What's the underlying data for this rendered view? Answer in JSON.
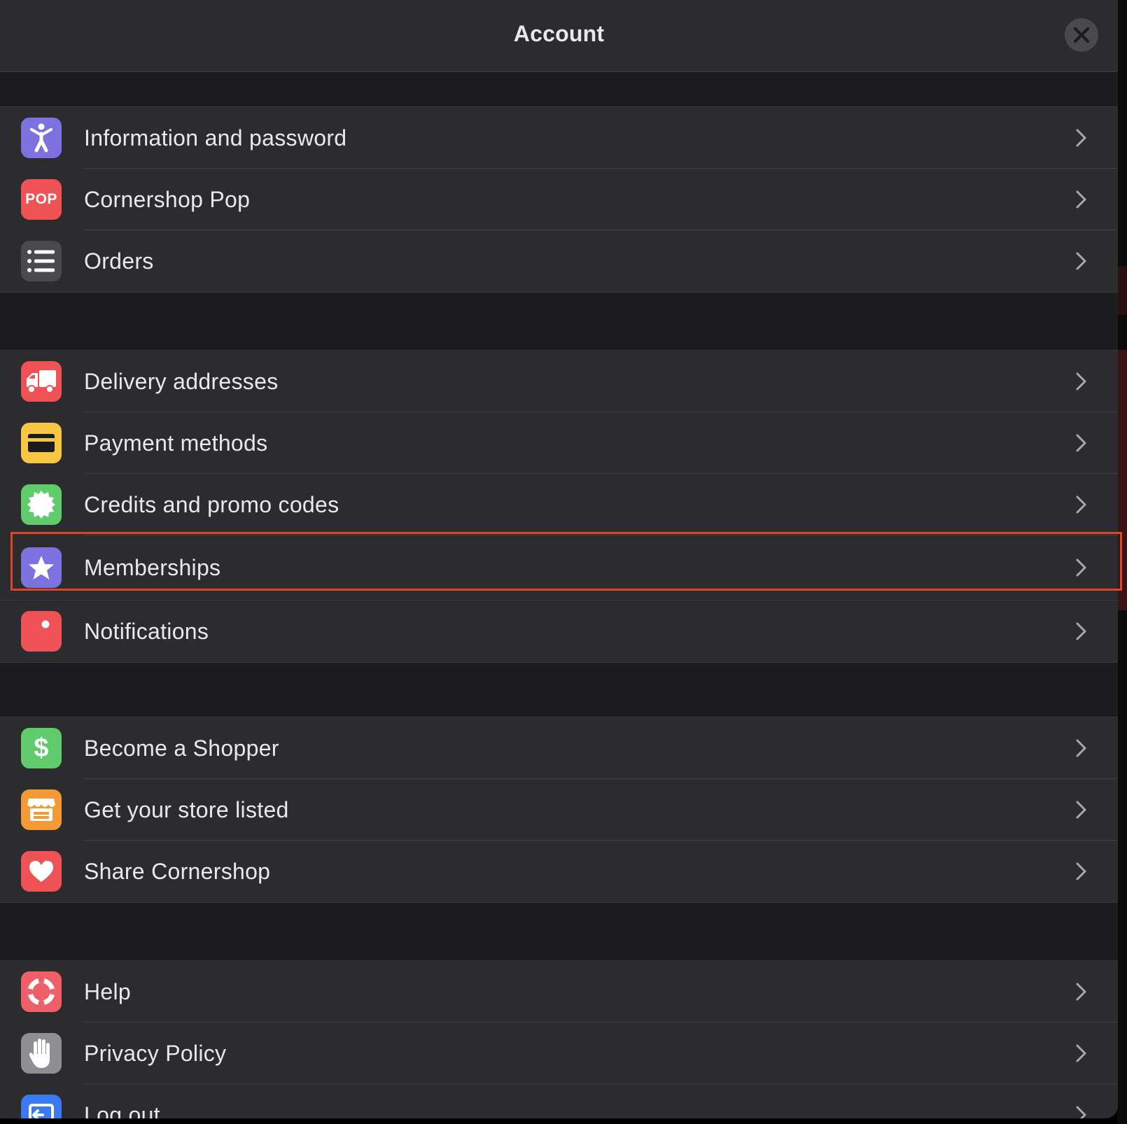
{
  "header": {
    "title": "Account",
    "close_icon": "close-icon"
  },
  "groups": [
    {
      "items": [
        {
          "label": "Information and password",
          "icon": "person-icon",
          "color": "#7b72e0"
        },
        {
          "label": "Cornershop Pop",
          "icon": "pop-icon",
          "color": "#ee5255",
          "icon_text": "POP"
        },
        {
          "label": "Orders",
          "icon": "list-icon",
          "color": "#4a4a4e"
        }
      ]
    },
    {
      "items": [
        {
          "label": "Delivery addresses",
          "icon": "truck-icon",
          "color": "#ee5255"
        },
        {
          "label": "Payment methods",
          "icon": "credit-card-icon",
          "color": "#f6c644"
        },
        {
          "label": "Credits and promo codes",
          "icon": "badge-icon",
          "color": "#5fcb6b"
        },
        {
          "label": "Memberships",
          "icon": "star-icon",
          "color": "#7b72e0",
          "highlighted": true
        },
        {
          "label": "Notifications",
          "icon": "notification-icon",
          "color": "#ee5255"
        }
      ]
    },
    {
      "items": [
        {
          "label": "Become a Shopper",
          "icon": "dollar-icon",
          "color": "#5fcb6b",
          "icon_text": "$"
        },
        {
          "label": "Get your store listed",
          "icon": "store-icon",
          "color": "#f39a36"
        },
        {
          "label": "Share Cornershop",
          "icon": "heart-icon",
          "color": "#ee5255"
        }
      ]
    },
    {
      "items": [
        {
          "label": "Help",
          "icon": "lifebuoy-icon",
          "color": "#ee5f6a"
        },
        {
          "label": "Privacy Policy",
          "icon": "hand-icon",
          "color": "#8e8e93"
        },
        {
          "label": "Log out",
          "icon": "logout-icon",
          "color": "#3a7af0"
        }
      ]
    }
  ],
  "colors": {
    "background": "#1c1c1e",
    "cell": "#2c2c2e",
    "text": "#e9e9eb",
    "chevron": "#a9a9ad",
    "highlight": "#e0432c"
  }
}
